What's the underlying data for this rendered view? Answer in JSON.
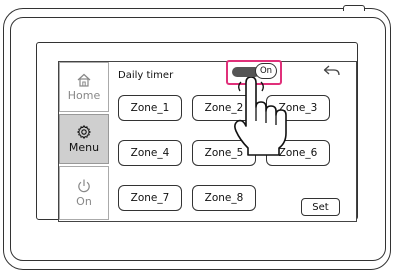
{
  "header": {
    "title": "Daily timer",
    "toggle_label": "On"
  },
  "sidebar": {
    "items": [
      {
        "label": "Home",
        "icon": "home-icon"
      },
      {
        "label": "Menu",
        "icon": "gear-icon"
      },
      {
        "label": "On",
        "icon": "power-icon"
      }
    ]
  },
  "zones": [
    {
      "label": "Zone_1"
    },
    {
      "label": "Zone_2"
    },
    {
      "label": "Zone_3"
    },
    {
      "label": "Zone_4"
    },
    {
      "label": "Zone_5"
    },
    {
      "label": "Zone_6"
    },
    {
      "label": "Zone_7"
    },
    {
      "label": "Zone_8"
    }
  ],
  "actions": {
    "set_label": "Set"
  },
  "colors": {
    "highlight": "#e0307a",
    "selected_sidebar_bg": "#cfcfcf",
    "toggle_track": "#555555"
  }
}
